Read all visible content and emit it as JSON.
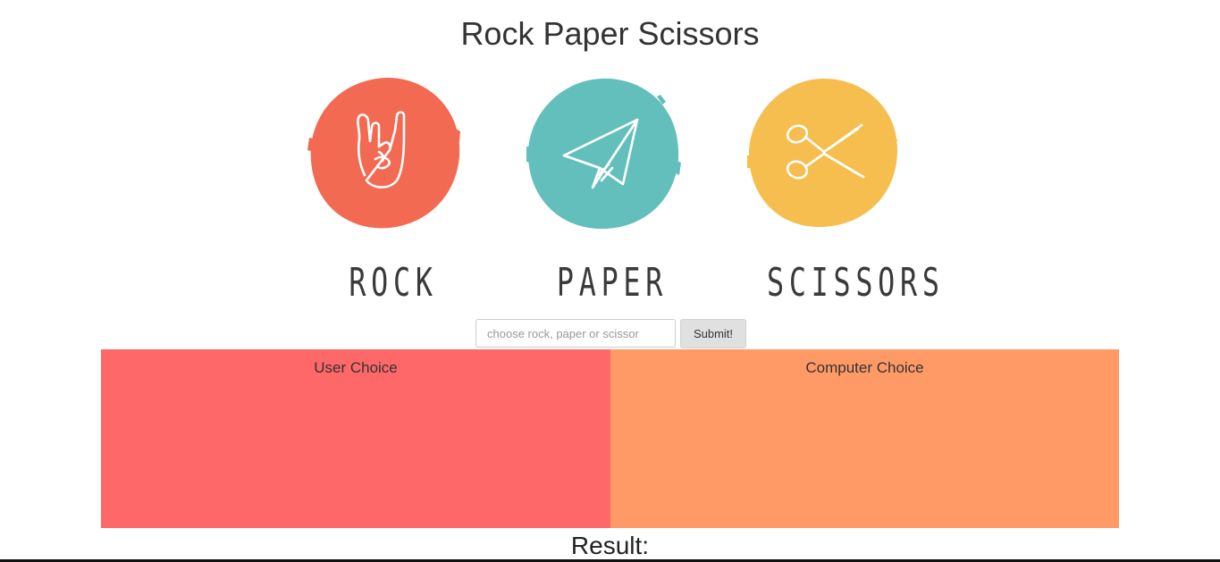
{
  "header": {
    "title": "Rock Paper Scissors"
  },
  "choices": [
    {
      "label": "ROCK",
      "icon": "rock-hand-icon",
      "color": "#f26a52"
    },
    {
      "label": "PAPER",
      "icon": "paper-plane-icon",
      "color": "#63bfbc"
    },
    {
      "label": "SCISSORS",
      "icon": "scissors-icon",
      "color": "#f6be4f"
    }
  ],
  "form": {
    "placeholder": "choose rock, paper or scissor",
    "value": "",
    "submit_label": "Submit!"
  },
  "panels": {
    "user": {
      "label": "User Choice",
      "color": "#ff6868"
    },
    "computer": {
      "label": "Computer Choice",
      "color": "#ff9a66"
    }
  },
  "result": {
    "label": "Result:"
  }
}
